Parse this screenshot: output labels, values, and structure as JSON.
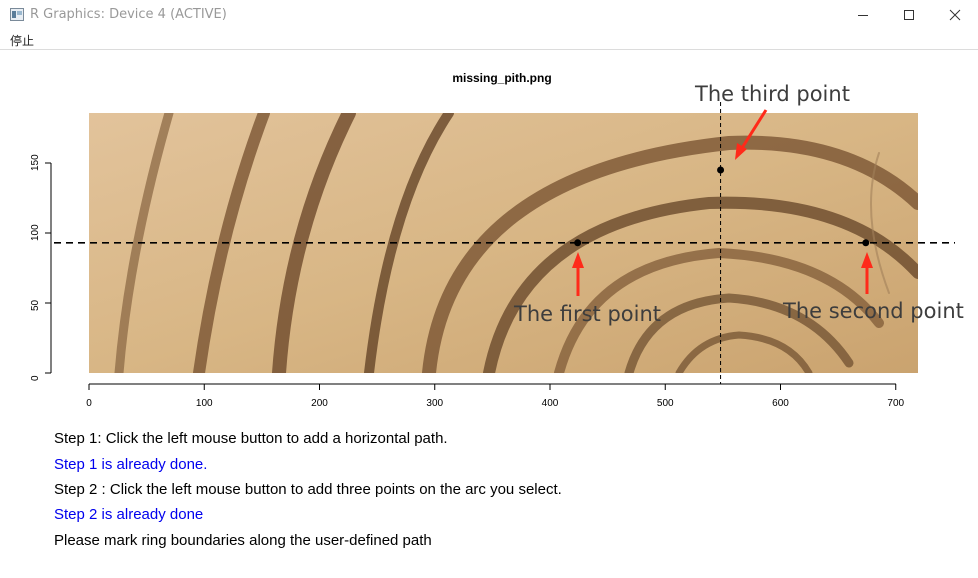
{
  "window": {
    "title": "R Graphics: Device 4 (ACTIVE)",
    "icon": "r-graphics-icon",
    "controls": [
      "minimize-icon",
      "maximize-icon",
      "close-icon"
    ]
  },
  "menu": {
    "stop_label": "停止"
  },
  "plot": {
    "title": "missing_pith.png",
    "x_ticks": [
      "0",
      "100",
      "200",
      "300",
      "400",
      "500",
      "600",
      "700"
    ],
    "y_ticks": [
      "0",
      "50",
      "100",
      "150"
    ],
    "xlim": [
      0,
      720
    ],
    "ylim": [
      0,
      180
    ],
    "horizontal_path_y": 93,
    "vertical_line_x": 548,
    "points": [
      {
        "x": 424,
        "y": 93,
        "label": "The first point"
      },
      {
        "x": 674,
        "y": 93,
        "label": "The second point"
      },
      {
        "x": 548,
        "y": 145,
        "label": "The third point"
      }
    ],
    "colors": {
      "arrow": "#ff2a1a",
      "wood_light": "#dcb98a",
      "wood_dark": "#8a6238"
    }
  },
  "messages": [
    {
      "text": "Step 1: Click the left mouse button to add a horizontal path.",
      "color": "#000000"
    },
    {
      "text": "Step 1 is already done.",
      "color": "#0000ee"
    },
    {
      "text": "Step 2 : Click the left mouse button to add three points on the arc you select.",
      "color": "#000000"
    },
    {
      "text": "Step 2 is already done",
      "color": "#0000ee"
    },
    {
      "text": "Please mark ring boundaries along the user-defined path",
      "color": "#000000"
    }
  ]
}
